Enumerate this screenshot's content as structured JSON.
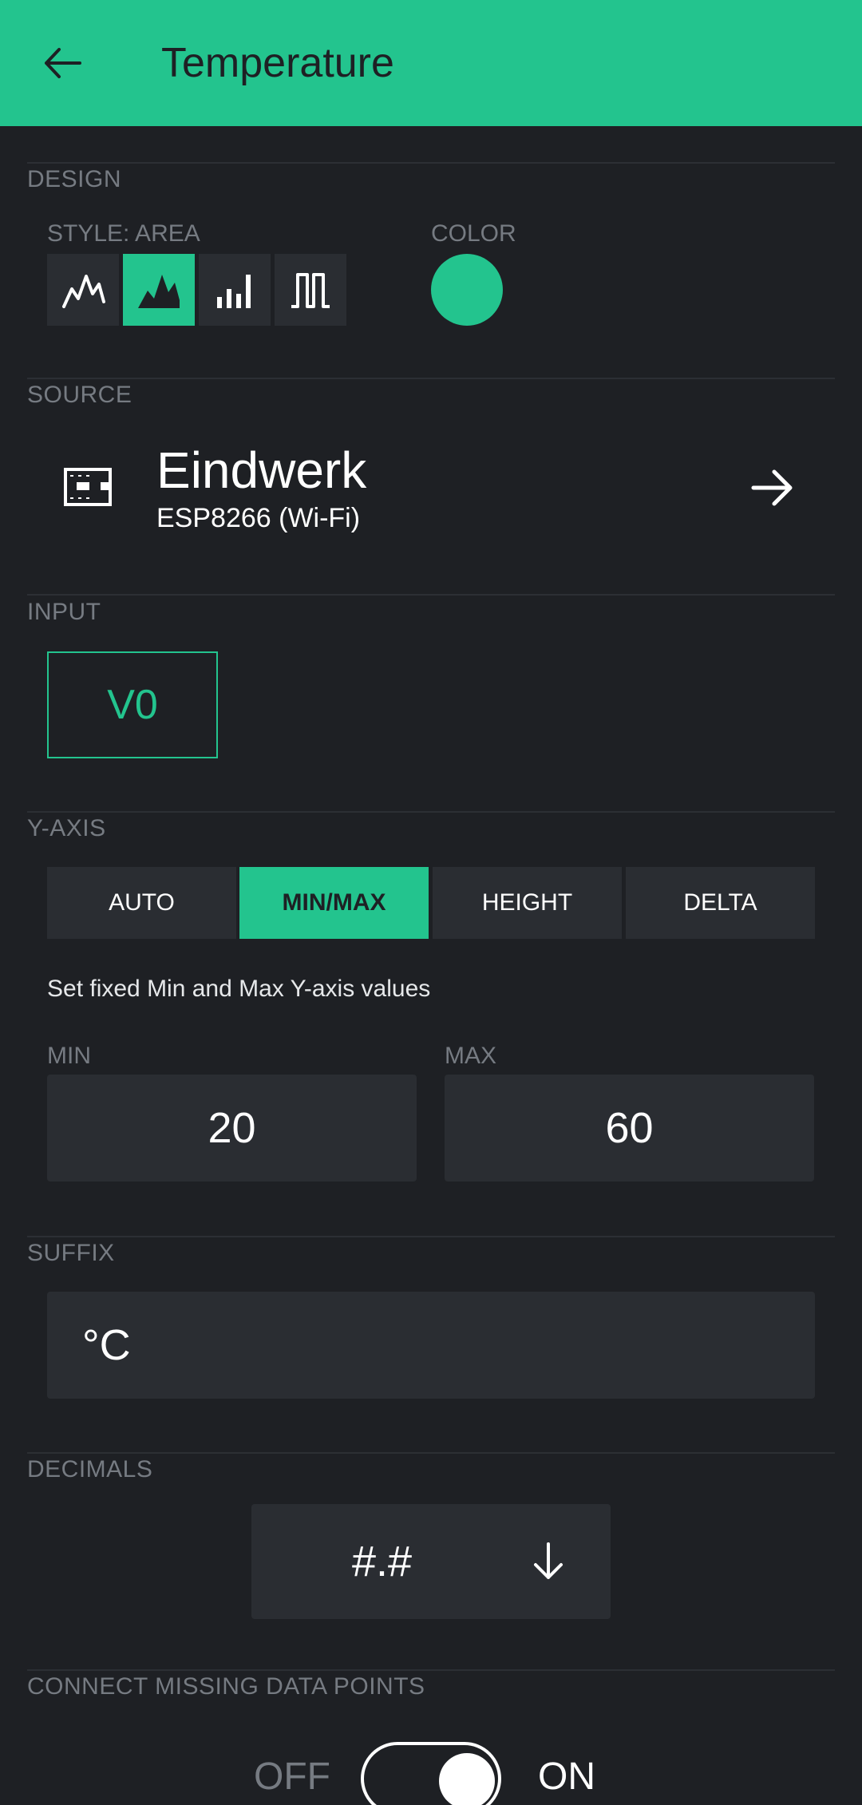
{
  "header": {
    "title": "Temperature",
    "back_icon": "arrow-left-icon"
  },
  "colors": {
    "accent": "#23c48e",
    "background": "#1e2024",
    "surface": "#2a2d32",
    "muted_text": "#767b82"
  },
  "design": {
    "section_label": "DESIGN",
    "style_label": "STYLE: AREA",
    "color_label": "COLOR",
    "styles": [
      {
        "icon": "line-chart-icon",
        "selected": false
      },
      {
        "icon": "area-chart-icon",
        "selected": true
      },
      {
        "icon": "bar-chart-icon",
        "selected": false
      },
      {
        "icon": "binary-chart-icon",
        "selected": false
      }
    ],
    "selected_color": "#23c48e"
  },
  "source": {
    "section_label": "SOURCE",
    "device_name": "Eindwerk",
    "device_model": "ESP8266 (Wi-Fi)",
    "device_icon": "chip-icon",
    "arrow_icon": "arrow-right-icon"
  },
  "input": {
    "section_label": "INPUT",
    "pin": "V0"
  },
  "y_axis": {
    "section_label": "Y-AXIS",
    "modes": [
      "AUTO",
      "MIN/MAX",
      "HEIGHT",
      "DELTA"
    ],
    "selected_mode": "MIN/MAX",
    "help_text": "Set fixed Min and Max Y-axis values",
    "min_label": "MIN",
    "min_value": "20",
    "max_label": "MAX",
    "max_value": "60"
  },
  "suffix": {
    "section_label": "SUFFIX",
    "value": "°C"
  },
  "decimals": {
    "section_label": "DECIMALS",
    "value": "#.#",
    "arrow_icon": "arrow-down-icon"
  },
  "connect_missing": {
    "section_label": "CONNECT MISSING DATA POINTS",
    "off_label": "OFF",
    "on_label": "ON",
    "state": "on"
  }
}
